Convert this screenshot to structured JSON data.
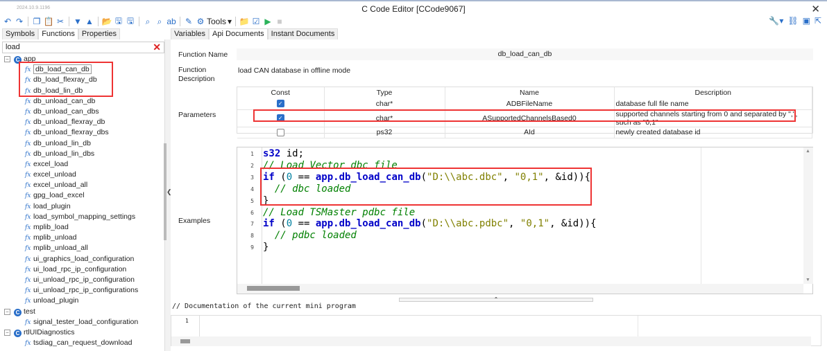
{
  "window": {
    "version": "2024.10.9.1196",
    "title": "C Code Editor [CCode9067]"
  },
  "toolbar": {
    "tools_label": "Tools"
  },
  "left_tabs": [
    "Symbols",
    "Functions",
    "Properties"
  ],
  "search": {
    "value": "load"
  },
  "tree": [
    {
      "type": "group",
      "label": "app"
    },
    {
      "type": "fn",
      "label": "db_load_can_db",
      "selected": true
    },
    {
      "type": "fn",
      "label": "db_load_flexray_db"
    },
    {
      "type": "fn",
      "label": "db_load_lin_db"
    },
    {
      "type": "fn",
      "label": "db_unload_can_db"
    },
    {
      "type": "fn",
      "label": "db_unload_can_dbs"
    },
    {
      "type": "fn",
      "label": "db_unload_flexray_db"
    },
    {
      "type": "fn",
      "label": "db_unload_flexray_dbs"
    },
    {
      "type": "fn",
      "label": "db_unload_lin_db"
    },
    {
      "type": "fn",
      "label": "db_unload_lin_dbs"
    },
    {
      "type": "fn",
      "label": "excel_load"
    },
    {
      "type": "fn",
      "label": "excel_unload"
    },
    {
      "type": "fn",
      "label": "excel_unload_all"
    },
    {
      "type": "fn",
      "label": "gpg_load_excel"
    },
    {
      "type": "fn",
      "label": "load_plugin"
    },
    {
      "type": "fn",
      "label": "load_symbol_mapping_settings"
    },
    {
      "type": "fn",
      "label": "mplib_load"
    },
    {
      "type": "fn",
      "label": "mplib_unload"
    },
    {
      "type": "fn",
      "label": "mplib_unload_all"
    },
    {
      "type": "fn",
      "label": "ui_graphics_load_configuration"
    },
    {
      "type": "fn",
      "label": "ui_load_rpc_ip_configuration"
    },
    {
      "type": "fn",
      "label": "ui_unload_rpc_ip_configuration"
    },
    {
      "type": "fn",
      "label": "ui_unload_rpc_ip_configurations"
    },
    {
      "type": "fn",
      "label": "unload_plugin"
    },
    {
      "type": "group",
      "label": "test"
    },
    {
      "type": "fn",
      "label": "signal_tester_load_configuration"
    },
    {
      "type": "group",
      "label": "rtlUIDiagnostics"
    },
    {
      "type": "fn",
      "label": "tsdiag_can_request_download"
    }
  ],
  "right_tabs": [
    "Variables",
    "Api Documents",
    "Instant Documents"
  ],
  "api": {
    "function_name_label": "Function Name",
    "function_name": "db_load_can_db",
    "function_desc_label": "Function Description",
    "function_desc": "load CAN database in offline mode",
    "parameters_label": "Parameters",
    "param_headers": [
      "Const",
      "Type",
      "Name",
      "Description"
    ],
    "params": [
      {
        "const": true,
        "type": "char*",
        "name": "ADBFileName",
        "desc": "database full file name"
      },
      {
        "const": true,
        "type": "char*",
        "name": "ASupportedChannelsBased0",
        "desc": "supported channels starting from 0 and separated by \",\", such as \"0,1\""
      },
      {
        "const": false,
        "type": "ps32",
        "name": "AId",
        "desc": "newly created database id"
      }
    ],
    "examples_label": "Examples",
    "code": [
      [
        [
          "k",
          "s32"
        ],
        [
          "p",
          " id;"
        ]
      ],
      [
        [
          "c",
          "// Load Vector dbc file"
        ]
      ],
      [
        [
          "k",
          "if"
        ],
        [
          "p",
          " ("
        ],
        [
          "n",
          "0"
        ],
        [
          "p",
          " == "
        ],
        [
          "k",
          "app.db_load_can_db"
        ],
        [
          "p",
          "("
        ],
        [
          "s",
          "\"D:\\\\abc.dbc\""
        ],
        [
          "p",
          ", "
        ],
        [
          "s",
          "\"0,1\""
        ],
        [
          "p",
          ", &id)){"
        ]
      ],
      [
        [
          "c",
          "  // dbc loaded"
        ]
      ],
      [
        [
          "p",
          "}"
        ]
      ],
      [
        [
          "c",
          "// Load TSMaster pdbc file"
        ]
      ],
      [
        [
          "k",
          "if"
        ],
        [
          "p",
          " ("
        ],
        [
          "n",
          "0"
        ],
        [
          "p",
          " == "
        ],
        [
          "k",
          "app.db_load_can_db"
        ],
        [
          "p",
          "("
        ],
        [
          "s",
          "\"D:\\\\abc.pdbc\""
        ],
        [
          "p",
          ", "
        ],
        [
          "s",
          "\"0,1\""
        ],
        [
          "p",
          ", &id)){"
        ]
      ],
      [
        [
          "c",
          "  // pdbc loaded"
        ]
      ],
      [
        [
          "p",
          "}"
        ]
      ]
    ]
  },
  "doc": {
    "title": "// Documentation of the current mini program",
    "lines": [
      "1"
    ]
  },
  "colors": {
    "accent": "#2a6fc9",
    "highlight": "#e33333",
    "keyword": "#0000c8",
    "comment": "#008000",
    "string": "#808000"
  }
}
